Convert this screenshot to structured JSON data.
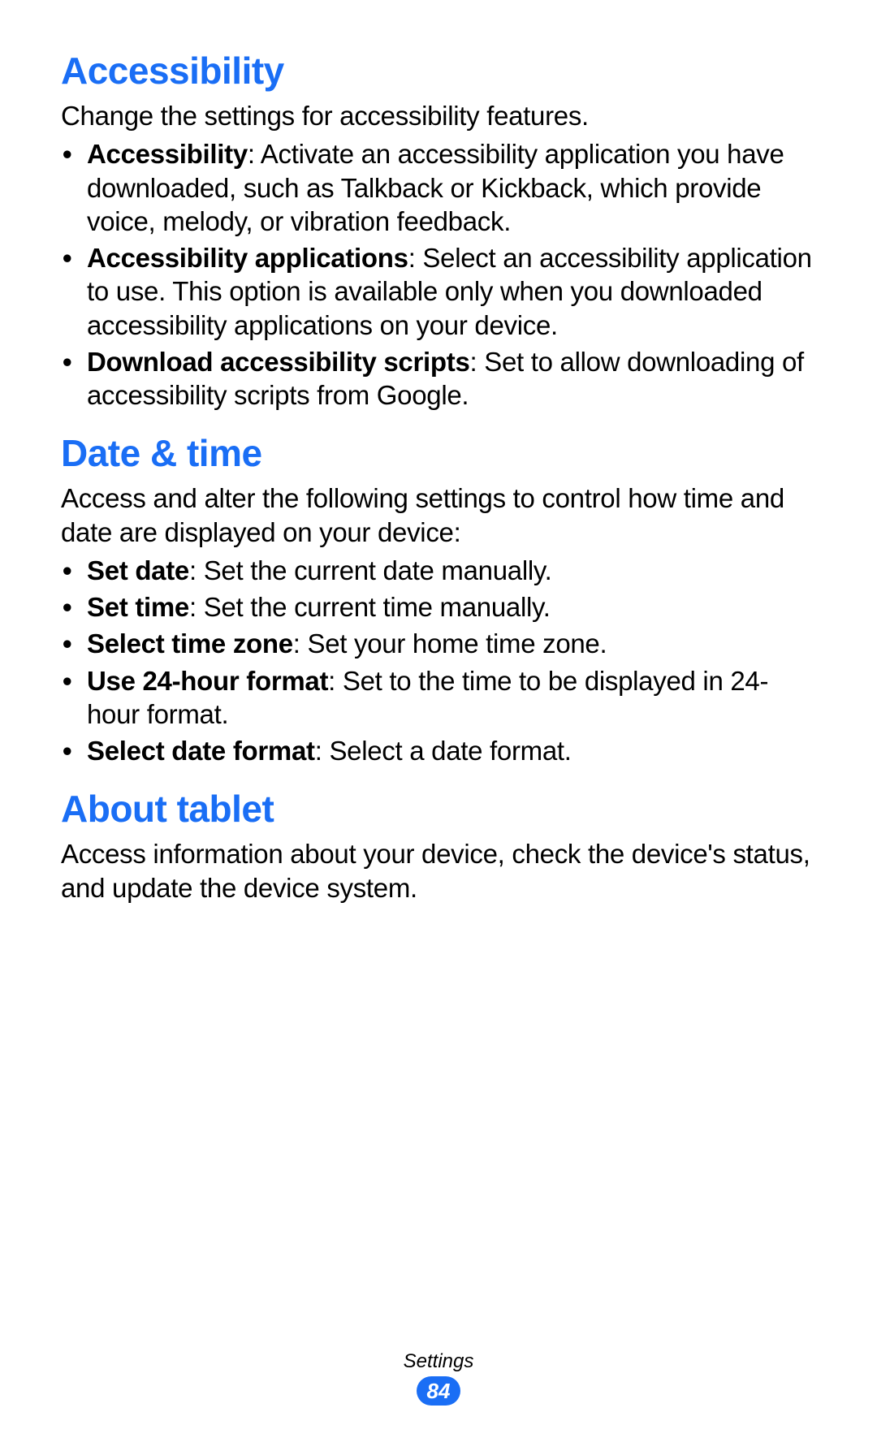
{
  "sections": [
    {
      "heading": "Accessibility",
      "intro": "Change the settings for accessibility features.",
      "items": [
        {
          "term": "Accessibility",
          "desc": ": Activate an accessibility application you have downloaded, such as Talkback or Kickback, which provide voice, melody, or vibration feedback."
        },
        {
          "term": "Accessibility applications",
          "desc": ": Select an accessibility application to use. This option is available only when you downloaded accessibility applications on your device."
        },
        {
          "term": "Download accessibility scripts",
          "desc": ": Set to allow downloading of accessibility scripts from Google."
        }
      ]
    },
    {
      "heading": "Date & time",
      "intro": "Access and alter the following settings to control how time and date are displayed on your device:",
      "items": [
        {
          "term": "Set date",
          "desc": ": Set the current date manually."
        },
        {
          "term": "Set time",
          "desc": ": Set the current time manually."
        },
        {
          "term": "Select time zone",
          "desc": ": Set your home time zone."
        },
        {
          "term": "Use 24-hour format",
          "desc": ": Set to the time to be displayed in 24-hour format."
        },
        {
          "term": "Select date format",
          "desc": ": Select a date format."
        }
      ]
    },
    {
      "heading": "About tablet",
      "intro": "Access information about your device, check the device's status, and update the device system.",
      "items": []
    }
  ],
  "footer": {
    "section_label": "Settings",
    "page_number": "84"
  }
}
